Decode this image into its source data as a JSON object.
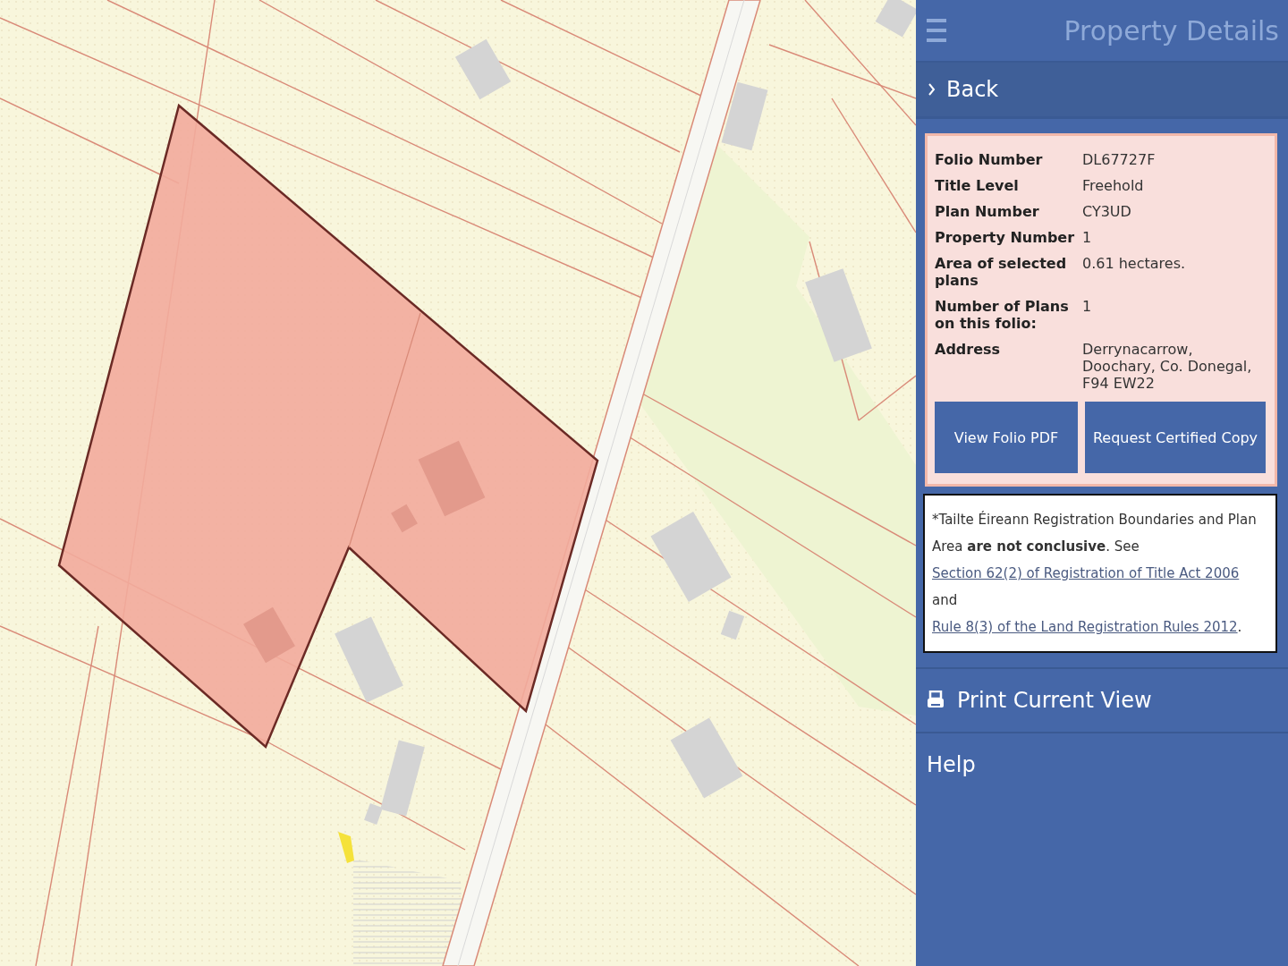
{
  "header": {
    "title": "Property Details"
  },
  "back": {
    "label": "Back"
  },
  "details": [
    {
      "label": "Folio Number",
      "value": "DL67727F"
    },
    {
      "label": "Title Level",
      "value": "Freehold"
    },
    {
      "label": "Plan Number",
      "value": "CY3UD"
    },
    {
      "label": "Property Number",
      "value": "1"
    },
    {
      "label": "Area of selected plans",
      "value": "0.61 hectares."
    },
    {
      "label": "Number of Plans on this folio:",
      "value": "1"
    },
    {
      "label": "Address",
      "value": "Derrynacarrow, Doochary, Co. Donegal, F94 EW22"
    }
  ],
  "buttons": [
    "View Folio PDF",
    "Request Certified Copy"
  ],
  "disclaimer": {
    "text": "*Tailte Éireann Registration Boundaries and Plan Area **are not conclusive**. See",
    "link_1": "Section 62(2) of Registration of Title Act 2006",
    "middle": "and",
    "link_2": "Rule 8(3) of the Land Registration Rules 2012",
    "end": "."
  },
  "menu": [
    {
      "kind": "print",
      "label": "Print Current View"
    },
    {
      "kind": "plain",
      "label": "Help"
    }
  ]
}
